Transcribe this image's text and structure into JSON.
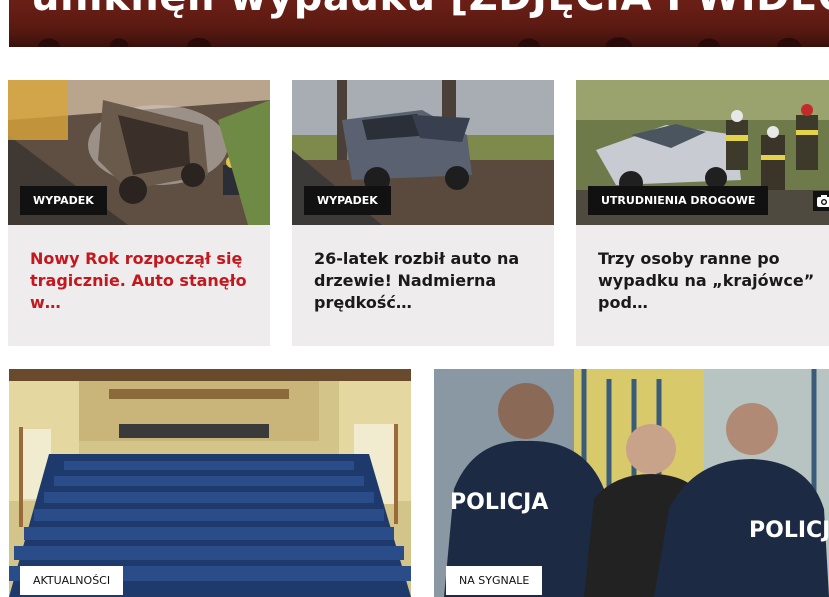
{
  "hero": {
    "title": "uniknęli wypadku [ZDJĘCIA I WIDEO]"
  },
  "articles": [
    {
      "category": "WYPADEK",
      "headline": "Nowy Rok rozpoczął się tragicznie. Auto stanęło w…"
    },
    {
      "category": "WYPADEK",
      "headline": "26-latek rozbił auto na drzewie! Nadmierna prędkość…"
    },
    {
      "category": "UTRUDNIENIA DROGOWE",
      "headline": "Trzy osoby ranne po wypadku na „krajówce” pod…"
    }
  ],
  "bottom": [
    {
      "category": "AKTUALNOŚCI"
    },
    {
      "category": "NA SYGNALE"
    }
  ],
  "icons": {
    "gallery": "camera-icon"
  },
  "colors": {
    "accent": "#c4171e",
    "card_bg": "#eeeced",
    "tag_bg": "#111111"
  }
}
